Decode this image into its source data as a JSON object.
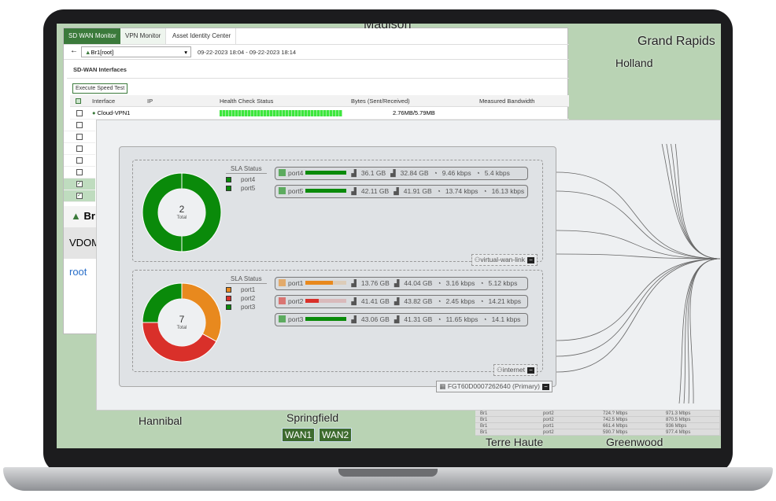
{
  "map": {
    "labels": [
      "Madison",
      "Grand Rapids",
      "Holland",
      "Hannibal",
      "Springfield",
      "Terre Haute",
      "Greenwood"
    ],
    "wan": [
      "WAN1",
      "WAN2"
    ]
  },
  "back": {
    "tabs": [
      "SD WAN Monitor",
      "VPN Monitor",
      "Asset Identity Center"
    ],
    "device": "Br1[root]",
    "range": "09-22-2023 18:04 - 09-22-2023 18:14",
    "section": "SD-WAN Interfaces",
    "speed_test": "Execute Speed Test",
    "columns": [
      "Interface",
      "IP",
      "Health Check Status",
      "Bytes (Sent/Received)",
      "Measured Bandwidth"
    ],
    "first_row": {
      "interface": "Cloud-VPN1",
      "bytes": "2.76MB/5.79MB"
    },
    "checked_rows": [
      false,
      false,
      false,
      false,
      false,
      false,
      true,
      true
    ],
    "bread": "Br",
    "vdom_header": "VDOM",
    "vdom": "root"
  },
  "front": {
    "groups": [
      {
        "total": "2",
        "total_label": "Total",
        "sla_title": "SLA Status",
        "legend": [
          {
            "name": "port4",
            "color": "#0a8a0a"
          },
          {
            "name": "port5",
            "color": "#0a8a0a"
          }
        ],
        "ports": [
          {
            "name": "port4",
            "color": "#0a8a0a",
            "fill": 100,
            "sent": "36.1 GB",
            "recv": "32.84 GB",
            "up": "9.46 kbps",
            "down": "5.4 kbps"
          },
          {
            "name": "port5",
            "color": "#0a8a0a",
            "fill": 100,
            "sent": "42.11 GB",
            "recv": "41.91 GB",
            "up": "13.74 kbps",
            "down": "16.13 kbps"
          }
        ],
        "tag": "virtual-wan-link"
      },
      {
        "total": "7",
        "total_label": "Total",
        "sla_title": "SLA Status",
        "legend": [
          {
            "name": "port1",
            "color": "#e8891e"
          },
          {
            "name": "port2",
            "color": "#d9302a"
          },
          {
            "name": "port3",
            "color": "#0a8a0a"
          }
        ],
        "ports": [
          {
            "name": "port1",
            "color": "#e8891e",
            "fill": 67,
            "sent": "13.76 GB",
            "recv": "44.04 GB",
            "up": "3.16 kbps",
            "down": "5.12 kbps"
          },
          {
            "name": "port2",
            "color": "#d9302a",
            "fill": 33,
            "sent": "41.41 GB",
            "recv": "43.82 GB",
            "up": "2.45 kbps",
            "down": "14.21 kbps"
          },
          {
            "name": "port3",
            "color": "#0a8a0a",
            "fill": 100,
            "sent": "43.06 GB",
            "recv": "41.31 GB",
            "up": "11.65 kbps",
            "down": "14.1 kbps"
          }
        ],
        "tag": "internet"
      }
    ],
    "device": "FGT60D0007262640 (Primary)"
  },
  "bottom_table": [
    [
      "Br1",
      "port2",
      "724.? Mbps",
      "971.3 Mbps"
    ],
    [
      "Br1",
      "port2",
      "742.5 Mbps",
      "870.5 Mbps"
    ],
    [
      "Br1",
      "port1",
      "661.4 Mbps",
      "936 Mbps"
    ],
    [
      "Br1",
      "port2",
      "590.7 Mbps",
      "977.4 Mbps"
    ]
  ]
}
